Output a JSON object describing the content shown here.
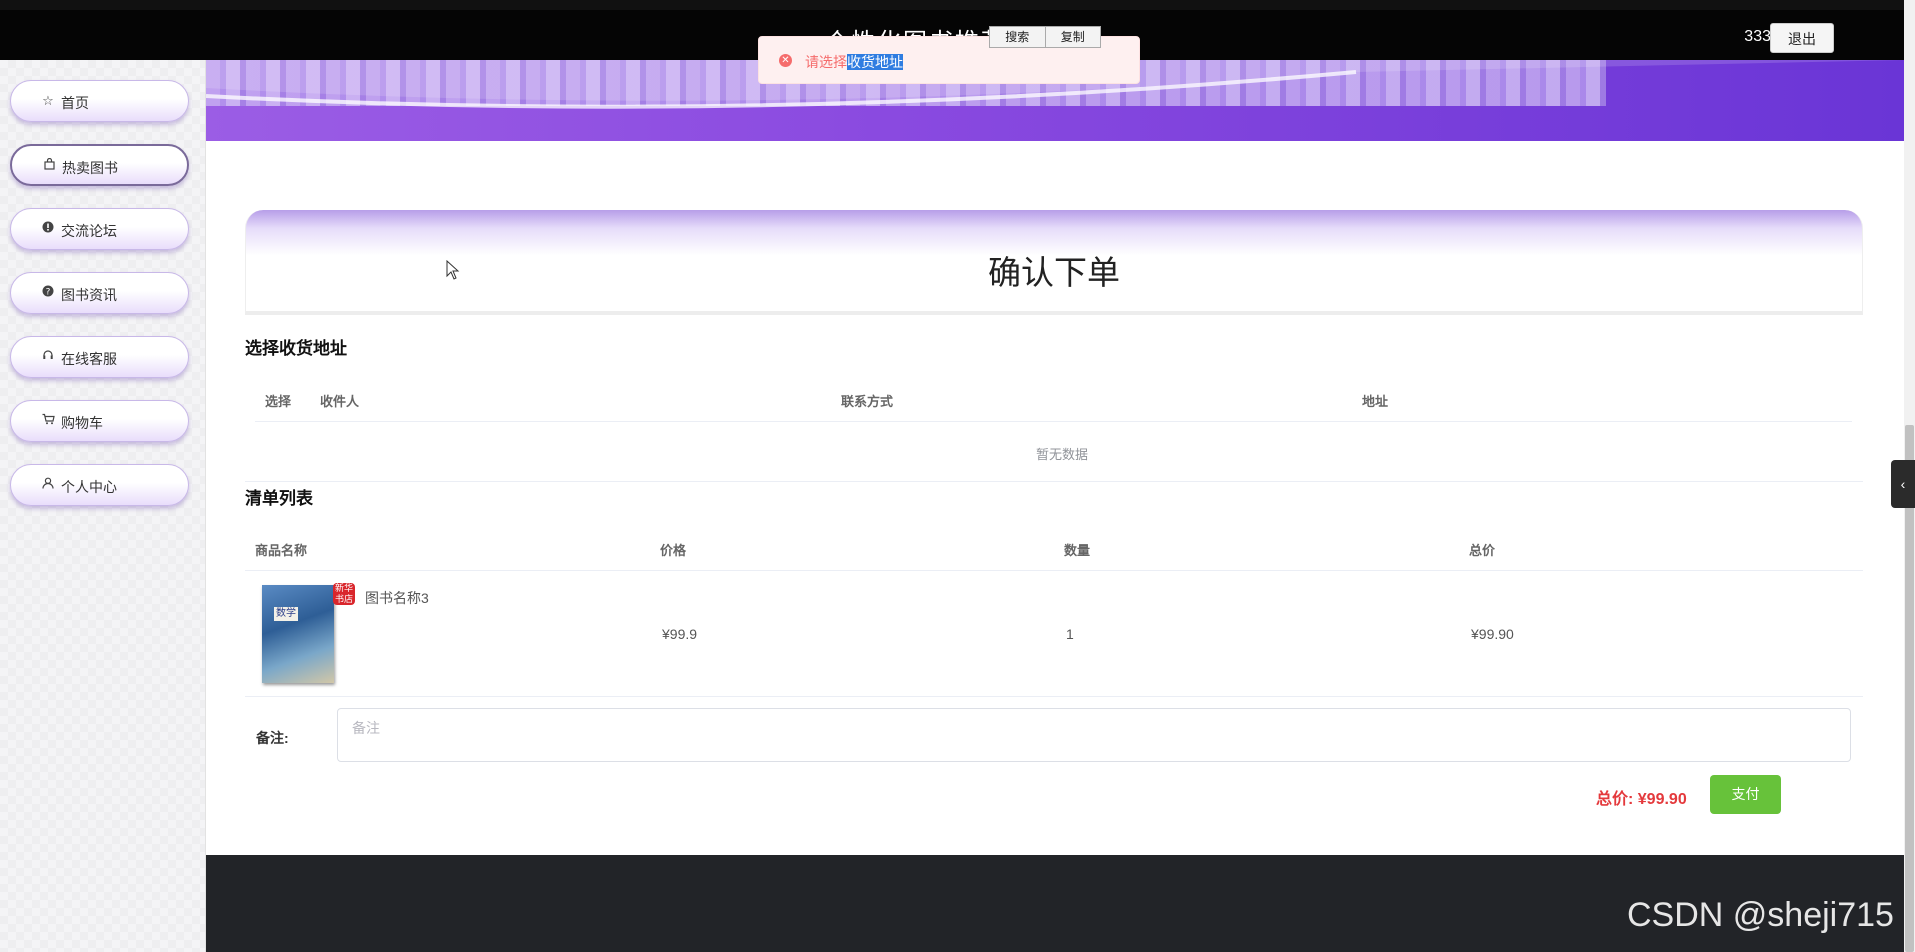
{
  "header": {
    "title": "个性化图书推荐系统",
    "username": "333",
    "logout_label": "退出"
  },
  "context_menu": {
    "items": [
      "搜索",
      "复制"
    ]
  },
  "toast": {
    "prefix": "请选择",
    "selected": "收货地址",
    "color": "#f56c6c"
  },
  "sidebar": {
    "items": [
      {
        "label": "首页",
        "icon": "star-icon"
      },
      {
        "label": "热卖图书",
        "icon": "bag-icon"
      },
      {
        "label": "交流论坛",
        "icon": "info-icon"
      },
      {
        "label": "图书资讯",
        "icon": "question-icon"
      },
      {
        "label": "在线客服",
        "icon": "headset-icon"
      },
      {
        "label": "购物车",
        "icon": "cart-icon"
      },
      {
        "label": "个人中心",
        "icon": "user-icon"
      }
    ],
    "active_index": 1
  },
  "page": {
    "title": "确认下单"
  },
  "address": {
    "section_title": "选择收货地址",
    "columns": [
      "选择",
      "收件人",
      "联系方式",
      "地址"
    ],
    "empty_text": "暂无数据"
  },
  "order": {
    "section_title": "清单列表",
    "columns": [
      "商品名称",
      "价格",
      "数量",
      "总价"
    ],
    "rows": [
      {
        "name": "图书名称3",
        "price": "¥99.9",
        "quantity": "1",
        "total": "¥99.90",
        "cover_text": "数学",
        "stamp_text": "新华书店"
      }
    ]
  },
  "remark": {
    "label": "备注:",
    "placeholder": "备注"
  },
  "summary": {
    "total_label": "总价: ¥99.90",
    "pay_label": "支付"
  },
  "watermark": "CSDN @sheji715",
  "colors": {
    "accent_purple": "#8a4ae0",
    "pay_green": "#67c23a",
    "price_red": "#e4393c"
  }
}
